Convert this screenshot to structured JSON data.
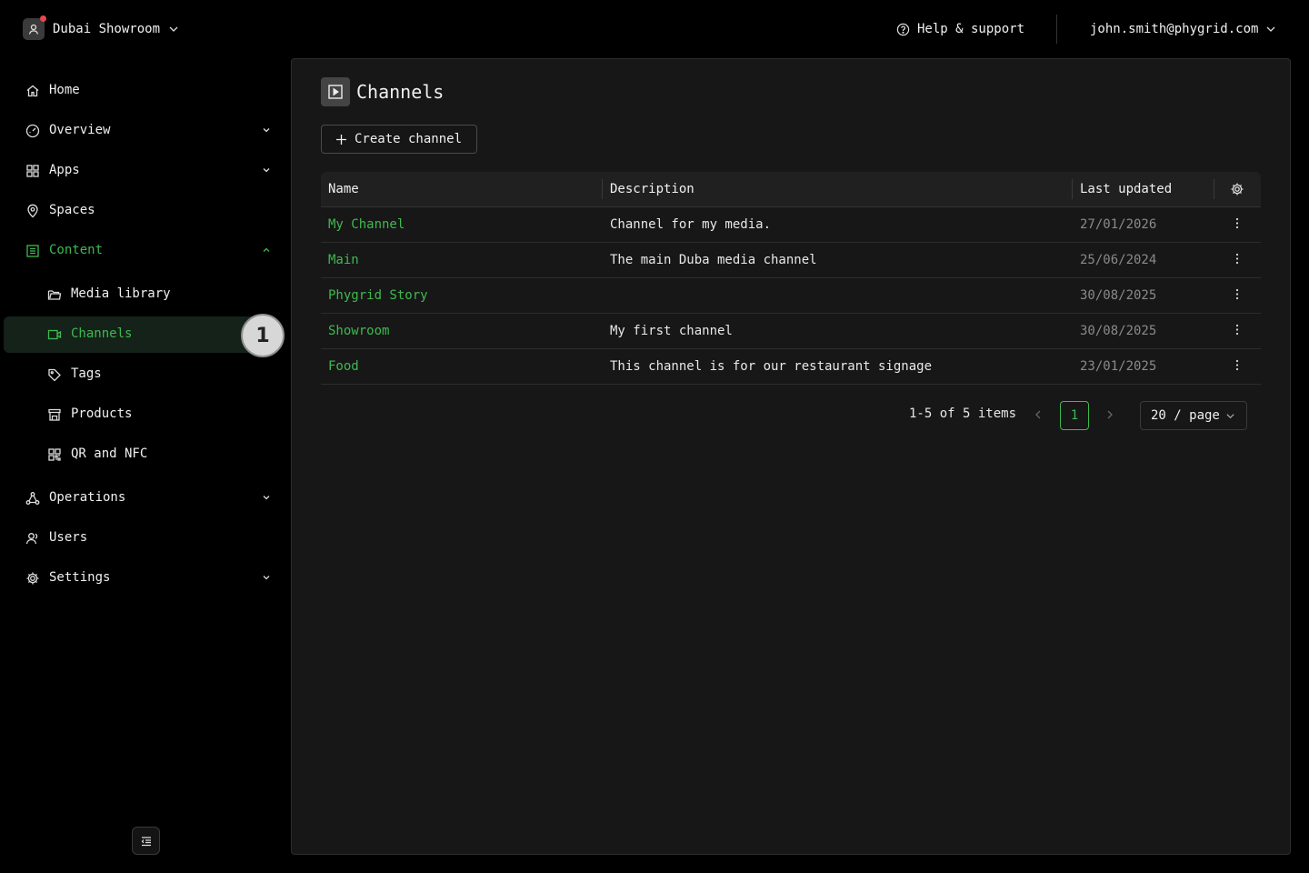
{
  "header": {
    "org_name": "Dubai Showroom",
    "help_label": "Help & support",
    "user_email": "john.smith@phygrid.com"
  },
  "sidebar": {
    "items": [
      {
        "label": "Home",
        "icon": "home-icon"
      },
      {
        "label": "Overview",
        "icon": "dashboard-icon",
        "expandable": true
      },
      {
        "label": "Apps",
        "icon": "apps-grid-icon",
        "expandable": true
      },
      {
        "label": "Spaces",
        "icon": "location-pin-icon"
      },
      {
        "label": "Content",
        "icon": "content-list-icon",
        "expandable": true,
        "expanded": true
      },
      {
        "label": "Media library",
        "icon": "folder-icon"
      },
      {
        "label": "Channels",
        "icon": "video-camera-icon",
        "active": true
      },
      {
        "label": "Tags",
        "icon": "tag-icon"
      },
      {
        "label": "Products",
        "icon": "store-icon"
      },
      {
        "label": "QR and NFC",
        "icon": "qr-code-icon"
      },
      {
        "label": "Operations",
        "icon": "network-icon",
        "expandable": true
      },
      {
        "label": "Users",
        "icon": "users-icon"
      },
      {
        "label": "Settings",
        "icon": "gear-icon",
        "expandable": true
      }
    ],
    "step_badge": "1"
  },
  "main": {
    "title": "Channels",
    "create_label": "Create channel",
    "columns": [
      "Name",
      "Description",
      "Last updated"
    ],
    "rows": [
      {
        "name": "My Channel",
        "description": "Channel for my media.",
        "updated": "27/01/2026"
      },
      {
        "name": "Main",
        "description": "The main Duba media channel",
        "updated": "25/06/2024"
      },
      {
        "name": "Phygrid Story",
        "description": "",
        "updated": "30/08/2025"
      },
      {
        "name": "Showroom",
        "description": "My first channel",
        "updated": "30/08/2025"
      },
      {
        "name": "Food",
        "description": "This channel is for our restaurant signage",
        "updated": "23/01/2025"
      }
    ],
    "pagination": {
      "total_text": "1-5 of 5 items",
      "current_page": "1",
      "page_size": "20 / page"
    }
  },
  "colors": {
    "accent": "#3fb950",
    "background": "#000000",
    "panel": "#171717",
    "badge": "#d7d7d7"
  }
}
